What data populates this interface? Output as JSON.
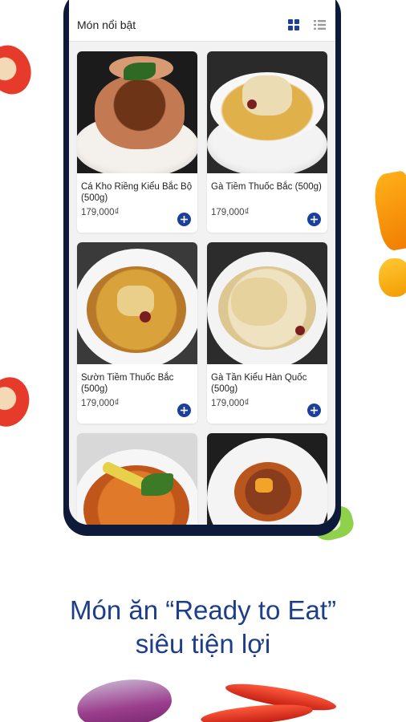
{
  "header": {
    "title": "Món nổi bật"
  },
  "view_toggle": {
    "grid_icon": "grid-view-icon",
    "list_icon": "list-view-icon",
    "active": "grid"
  },
  "products": [
    {
      "name": "Cá Kho Riềng Kiểu Bắc Bộ (500g)",
      "price": "179,000₫",
      "dish": "fish-claypot"
    },
    {
      "name": "Gà Tiềm Thuốc Bắc (500g)",
      "price": "179,000₫",
      "dish": "herbal-chicken"
    },
    {
      "name": "Sườn Tiềm Thuốc Bắc (500g)",
      "price": "179,000₫",
      "dish": "herbal-ribs"
    },
    {
      "name": "Gà Tần Kiểu Hàn Quốc (500g)",
      "price": "179,000₫",
      "dish": "korean-chicken"
    },
    {
      "name": "",
      "price": "",
      "dish": "stew-lemongrass"
    },
    {
      "name": "",
      "price": "",
      "dish": "beef-stew"
    }
  ],
  "tagline": {
    "line1": "Món ăn “Ready to Eat”",
    "line2": "siêu tiện lợi"
  },
  "colors": {
    "accent": "#1c3f9c",
    "tagline": "#1d3e8c",
    "phone_frame": "#0d1a3a"
  }
}
